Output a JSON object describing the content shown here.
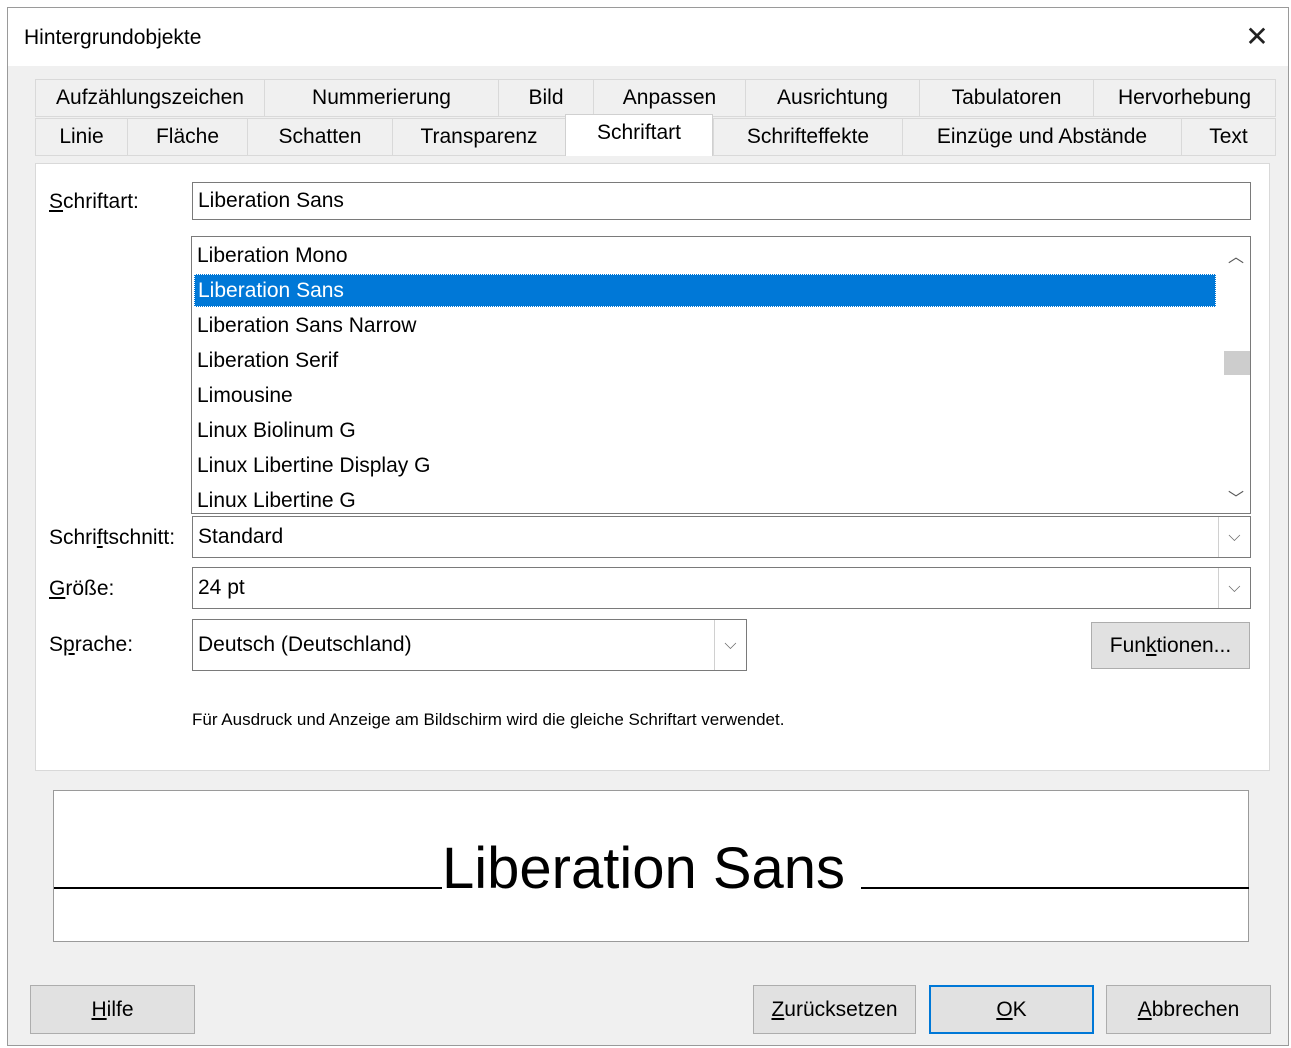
{
  "window": {
    "title": "Hintergrundobjekte",
    "close_glyph": "✕"
  },
  "tabs_row1": [
    "Aufzählungszeichen",
    "Nummerierung",
    "Bild",
    "Anpassen",
    "Ausrichtung",
    "Tabulatoren",
    "Hervorhebung"
  ],
  "tabs_row2": [
    "Linie",
    "Fläche",
    "Schatten",
    "Transparenz",
    "Schriftart",
    "Schrifteffekte",
    "Einzüge und Abstände",
    "Text"
  ],
  "active_tab": "Schriftart",
  "font": {
    "label_pre": "",
    "label_u": "S",
    "label_post": "chriftart:",
    "value": "Liberation Sans",
    "list": [
      "Liberation Mono",
      "Liberation Sans",
      "Liberation Sans Narrow",
      "Liberation Serif",
      "Limousine",
      "Linux Biolinum G",
      "Linux Libertine Display G",
      "Linux Libertine G"
    ],
    "selected_index": 1
  },
  "style": {
    "label_pre": "Schri",
    "label_u": "f",
    "label_post": "tschnitt:",
    "value": "Standard"
  },
  "size": {
    "label_pre": "",
    "label_u": "G",
    "label_post": "röße:",
    "value": "24 pt"
  },
  "language": {
    "label_pre": "S",
    "label_u": "p",
    "label_post": "rache:",
    "value": "Deutsch (Deutschland)"
  },
  "features_button": {
    "pre": "Fun",
    "u": "k",
    "post": "tionen..."
  },
  "info_text": "Für Ausdruck und Anzeige am Bildschirm wird die gleiche Schriftart verwendet.",
  "preview_text": "Liberation Sans",
  "buttons": {
    "help": {
      "pre": "",
      "u": "H",
      "post": "ilfe"
    },
    "reset": {
      "pre": "",
      "u": "Z",
      "post": "urücksetzen"
    },
    "ok": {
      "pre": "",
      "u": "O",
      "post": "K"
    },
    "cancel": {
      "pre": "",
      "u": "A",
      "post": "bbrechen"
    }
  },
  "glyphs": {
    "chevron_up": "︿",
    "chevron_down": "﹀",
    "combo_down": "⌵"
  },
  "colors": {
    "selection": "#0078d7",
    "default_button_border": "#0078d7"
  }
}
